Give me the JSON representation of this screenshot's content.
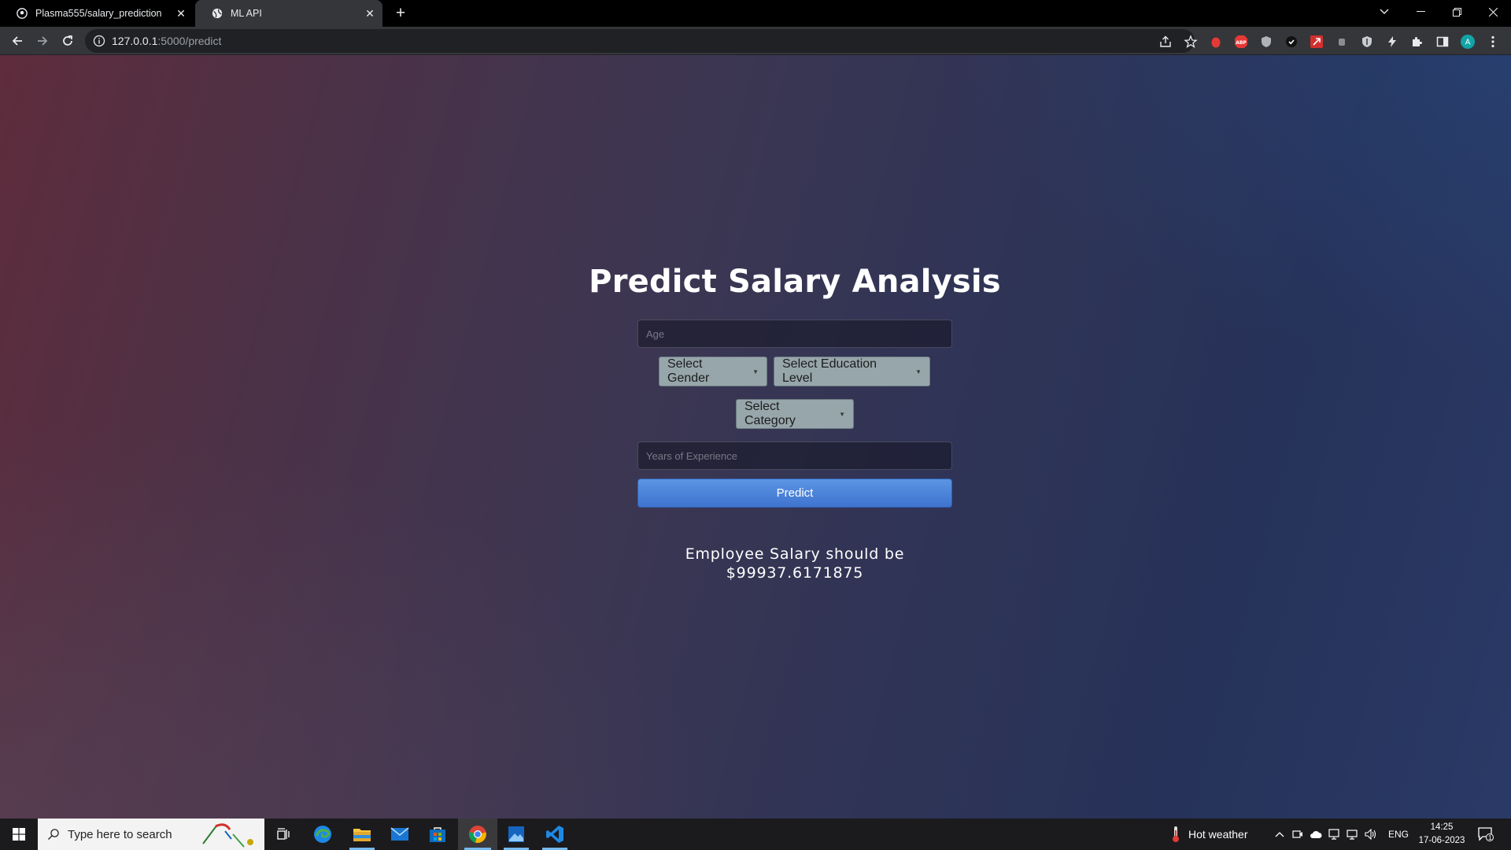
{
  "browser": {
    "tabs": [
      {
        "title": "Plasma555/salary_prediction",
        "favicon": "github-icon",
        "active": false
      },
      {
        "title": "ML API",
        "favicon": "globe-icon",
        "active": true
      }
    ],
    "url_host": "127.0.0.1",
    "url_rest": ":5000/predict"
  },
  "page": {
    "title": "Predict Salary Analysis",
    "age_placeholder": "Age",
    "gender_select": "Select Gender",
    "education_select": "Select Education Level",
    "category_select": "Select Category",
    "experience_placeholder": "Years of Experience",
    "predict_label": "Predict",
    "result_line1": "Employee Salary should be",
    "result_line2": "$99937.6171875"
  },
  "taskbar": {
    "search_placeholder": "Type here to search",
    "weather": "Hot weather",
    "language": "ENG",
    "time": "14:25",
    "date": "17-06-2023",
    "notification_count": "1"
  },
  "colors": {
    "accent": "#4a80d9",
    "select_bg": "#97a6ab",
    "taskbar_active": "#76b9ed"
  }
}
